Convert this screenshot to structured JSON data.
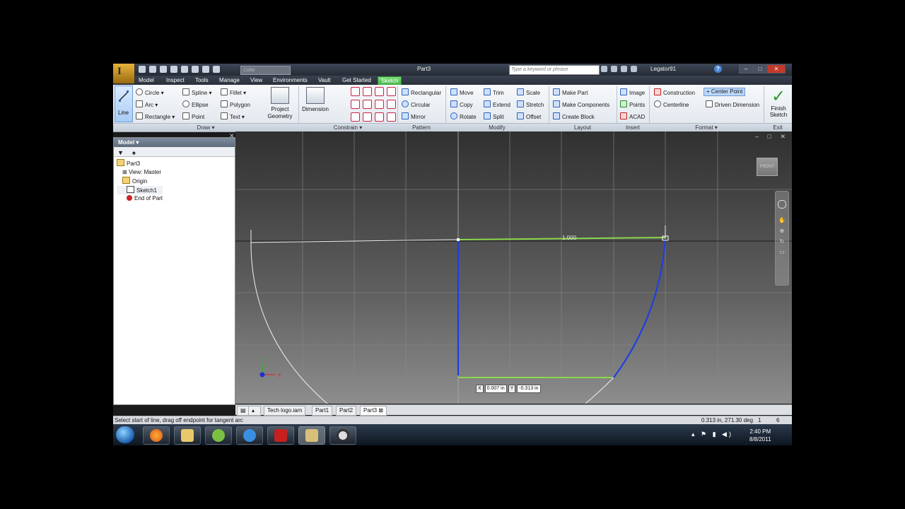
{
  "app": {
    "logo_letter": "I",
    "title": "Part3",
    "color_box": "Color",
    "search_placeholder": "Type a keyword or phrase",
    "user": "Legator91",
    "help": "?"
  },
  "menu_tabs": [
    "Model",
    "Inspect",
    "Tools",
    "Manage",
    "View",
    "Environments",
    "Vault",
    "Get Started",
    "Sketch"
  ],
  "ribbon": {
    "line": "Line",
    "draw": {
      "circle": "Circle",
      "arc": "Arc",
      "rectangle": "Rectangle",
      "spline": "Spline",
      "ellipse": "Ellipse",
      "point": "Point",
      "fillet": "Fillet",
      "polygon": "Polygon",
      "text": "Text"
    },
    "project_geometry": "Project Geometry",
    "dimension": "Dimension",
    "pattern": {
      "rectangular": "Rectangular",
      "circular": "Circular",
      "mirror": "Mirror"
    },
    "modify": {
      "move": "Move",
      "copy": "Copy",
      "rotate": "Rotate",
      "trim": "Trim",
      "extend": "Extend",
      "split": "Split",
      "scale": "Scale",
      "stretch": "Stretch",
      "offset": "Offset"
    },
    "layout": {
      "make_part": "Make Part",
      "make_components": "Make Components",
      "create_block": "Create Block"
    },
    "insert": {
      "image": "Image",
      "points": "Points",
      "acad": "ACAD"
    },
    "format": {
      "construction": "Construction",
      "centerline": "Centerline",
      "center_point": "Center Point",
      "driven_dimension": "Driven Dimension"
    },
    "finish": "Finish Sketch",
    "groups": {
      "draw": "Draw ▾",
      "constrain": "Constrain ▾",
      "pattern": "Pattern",
      "modify": "Modify",
      "layout": "Layout",
      "insert": "Insert",
      "format": "Format ▾",
      "exit": "Exit"
    }
  },
  "browser": {
    "title": "Model ▾",
    "tree": [
      "Part3",
      "View: Master",
      "Origin",
      "Sketch1",
      "End of Part"
    ]
  },
  "viewport": {
    "dimension_text": "1.000",
    "viewcube": "FRONT",
    "coord": {
      "x_label": "X",
      "x_value": "0.007 in",
      "y_label": "Y",
      "y_value": "-0.313 in"
    },
    "axis_x": "X",
    "axis_y": "Y"
  },
  "doc_tabs": [
    "Tech logo.iam",
    "Part1",
    "Part2",
    "Part3"
  ],
  "status": {
    "left": "Select start of line, drag off endpoint for tangent arc",
    "right": "0.313 in, 271.30 deg",
    "n1": "1",
    "n2": "6"
  },
  "taskbar": {
    "time": "2:40 PM",
    "date": "8/8/2011"
  },
  "colors": {
    "sketch_blue": "#1f3fe0",
    "sketch_green": "#8bd84b",
    "sketch_white": "#f0f0f0",
    "ribbon_active": "#55c055"
  }
}
